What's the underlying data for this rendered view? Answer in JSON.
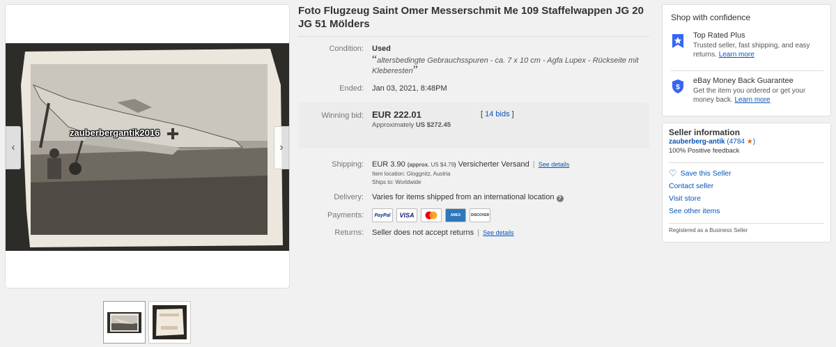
{
  "gallery": {
    "watermark": "zauberbergantik2016",
    "prev_icon": "chevron-left-icon",
    "next_icon": "chevron-right-icon",
    "thumbnails": [
      "thumbnail-front",
      "thumbnail-back"
    ]
  },
  "item": {
    "title": "Foto Flugzeug Saint Omer Messerschmit Me 109 Staffelwappen JG 20 JG 51 Mölders",
    "condition_label": "Condition:",
    "condition_value": "Used",
    "condition_desc": "altersbedingte Gebrauchsspuren - ca. 7 x 10 cm - Agfa Lupex - Rückseite mit Kleberesten",
    "ended_label": "Ended:",
    "ended_value": "Jan 03, 2021, 8:48PM",
    "bid_label": "Winning bid:",
    "bid_amount": "EUR 222.01",
    "bid_approx_prefix": "Approximately",
    "bid_approx_value": "US $272.45",
    "bid_count_open": "[",
    "bid_count": "14 bids",
    "bid_count_close": "]",
    "shipping_label": "Shipping:",
    "shipping_amount": "EUR 3.90",
    "shipping_approx_open": "(approx.",
    "shipping_approx_value": "US $4.79",
    "shipping_approx_close": ")",
    "shipping_method": "Versicherter Versand",
    "see_details": "See details",
    "item_location": "Item location:  Gloggnitz, Austria",
    "ships_to": "Ships to:  Worldwide",
    "delivery_label": "Delivery:",
    "delivery_value": "Varies for items shipped from an international location",
    "payments_label": "Payments:",
    "payments": [
      "PayPal",
      "VISA",
      "Mastercard",
      "AMEX",
      "DISCOVER"
    ],
    "returns_label": "Returns:",
    "returns_value": "Seller does not accept returns",
    "returns_see_details": "See details"
  },
  "confidence": {
    "title": "Shop with confidence",
    "top_rated_title": "Top Rated Plus",
    "top_rated_desc": "Trusted seller, fast shipping, and easy returns.",
    "top_rated_link": "Learn more",
    "guarantee_title": "eBay Money Back Guarantee",
    "guarantee_desc": "Get the item you ordered or get your money back.",
    "guarantee_link": "Learn more"
  },
  "seller": {
    "title": "Seller information",
    "name": "zauberberg-antik",
    "score": "4784",
    "score_open": "(",
    "score_close": ")",
    "feedback": "100% Positive feedback",
    "save_seller": "Save this Seller",
    "contact": "Contact seller",
    "visit_store": "Visit store",
    "see_other": "See other items",
    "business": "Registered as a Business Seller"
  },
  "colors": {
    "link": "#0654ba",
    "star": "#e06a1b",
    "bid_box": "#ececec"
  }
}
